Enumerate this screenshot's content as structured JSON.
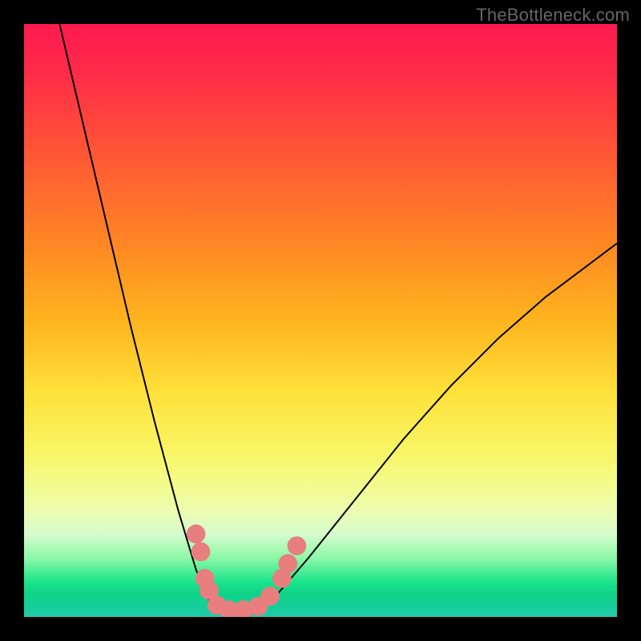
{
  "watermark": "TheBottleneck.com",
  "chart_data": {
    "type": "line",
    "title": "",
    "xlabel": "",
    "ylabel": "",
    "xlim": [
      0,
      100
    ],
    "ylim": [
      0,
      100
    ],
    "background_gradient": {
      "direction": "vertical",
      "stops": [
        {
          "pos": 0,
          "color": "#ff1a50"
        },
        {
          "pos": 18,
          "color": "#ff4a3a"
        },
        {
          "pos": 38,
          "color": "#ff8a23"
        },
        {
          "pos": 62,
          "color": "#ffe13a"
        },
        {
          "pos": 82,
          "color": "#edfcb0"
        },
        {
          "pos": 94,
          "color": "#1de58c"
        },
        {
          "pos": 100,
          "color": "#22c9ab"
        }
      ]
    },
    "series": [
      {
        "name": "bottleneck-curve-left",
        "color": "#000000",
        "x": [
          6,
          10,
          14,
          18,
          22,
          26,
          29,
          31
        ],
        "y": [
          100,
          83,
          66,
          49,
          33,
          18,
          8,
          3
        ]
      },
      {
        "name": "bottleneck-curve-floor",
        "color": "#000000",
        "x": [
          31,
          34,
          38,
          42
        ],
        "y": [
          3,
          1,
          1,
          3
        ]
      },
      {
        "name": "bottleneck-curve-right",
        "color": "#000000",
        "x": [
          42,
          48,
          56,
          64,
          72,
          80,
          88,
          96,
          100
        ],
        "y": [
          3,
          10,
          20,
          30,
          39,
          47,
          54,
          60,
          63
        ]
      }
    ],
    "markers": [
      {
        "name": "left-dot-1",
        "x": 29.0,
        "y": 14.0,
        "r": 1.6,
        "color": "#e97e7e"
      },
      {
        "name": "left-dot-2",
        "x": 29.8,
        "y": 11.0,
        "r": 1.6,
        "color": "#e97e7e"
      },
      {
        "name": "left-dot-3",
        "x": 30.5,
        "y": 6.5,
        "r": 1.6,
        "color": "#e97e7e"
      },
      {
        "name": "left-dot-4",
        "x": 31.2,
        "y": 4.5,
        "r": 1.6,
        "color": "#e97e7e"
      },
      {
        "name": "floor-dot-1",
        "x": 32.5,
        "y": 2.0,
        "r": 1.6,
        "color": "#e97e7e"
      },
      {
        "name": "floor-dot-2",
        "x": 34.5,
        "y": 1.2,
        "r": 1.6,
        "color": "#e97e7e"
      },
      {
        "name": "floor-dot-3",
        "x": 37.0,
        "y": 1.2,
        "r": 1.6,
        "color": "#e97e7e"
      },
      {
        "name": "floor-dot-4",
        "x": 39.5,
        "y": 1.8,
        "r": 1.6,
        "color": "#e97e7e"
      },
      {
        "name": "right-dot-1",
        "x": 41.5,
        "y": 3.5,
        "r": 1.6,
        "color": "#e97e7e"
      },
      {
        "name": "right-dot-2",
        "x": 43.5,
        "y": 6.5,
        "r": 1.6,
        "color": "#e97e7e"
      },
      {
        "name": "right-dot-3",
        "x": 44.5,
        "y": 9.0,
        "r": 1.6,
        "color": "#e97e7e"
      },
      {
        "name": "right-dot-4",
        "x": 46.0,
        "y": 12.0,
        "r": 1.6,
        "color": "#e97e7e"
      }
    ]
  }
}
